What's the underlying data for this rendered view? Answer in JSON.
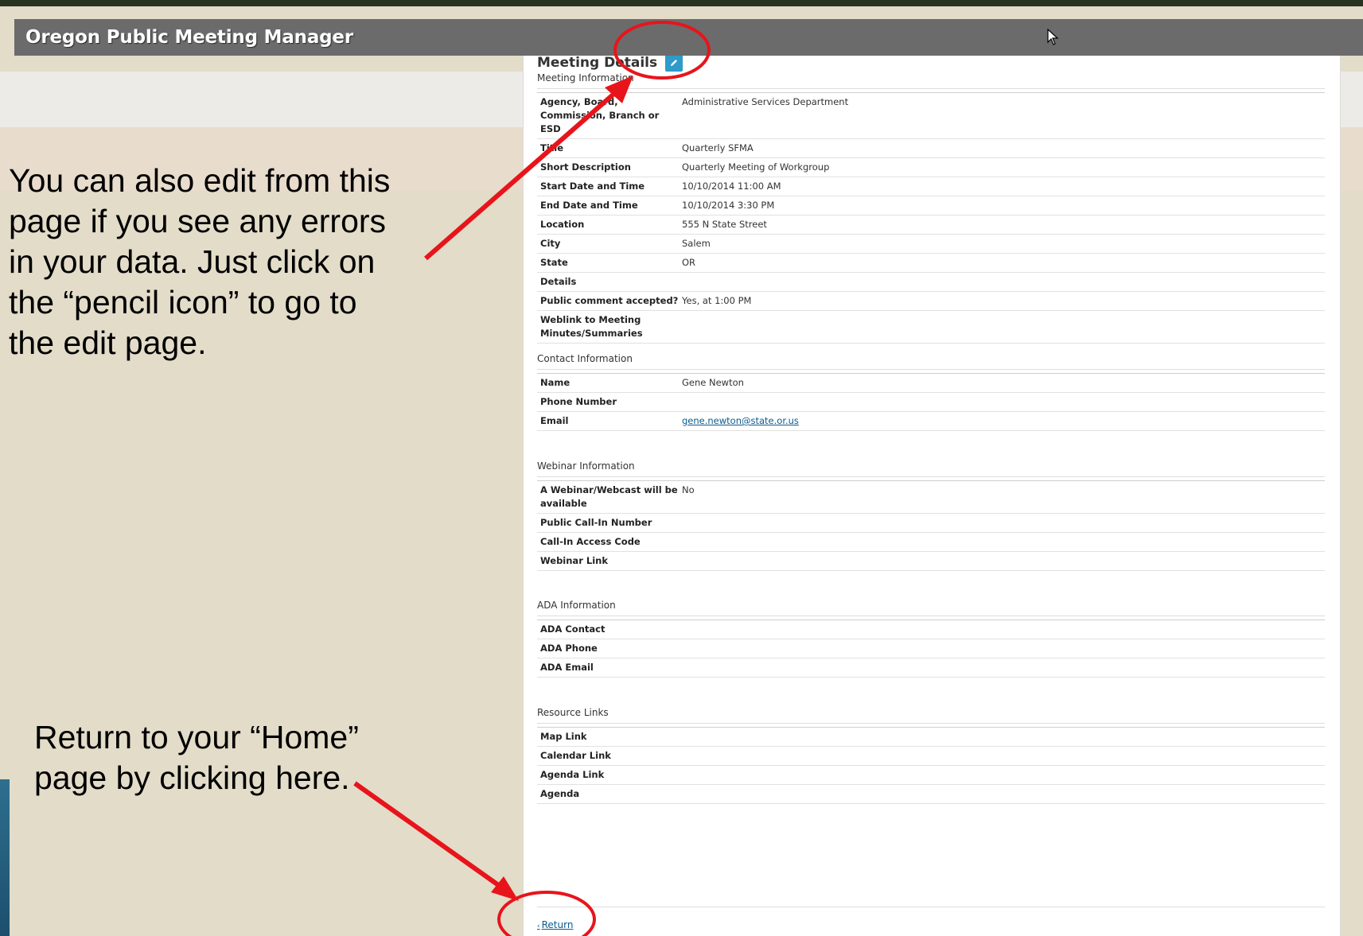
{
  "app": {
    "title": "Oregon Public Meeting Manager"
  },
  "panel": {
    "title": "Meeting Details",
    "edit_icon": "pencil-icon"
  },
  "sections": {
    "meeting": {
      "title": "Meeting Information",
      "rows": [
        {
          "label": "Agency, Board, Commission, Branch or ESD",
          "value": "Administrative Services Department"
        },
        {
          "label": "Title",
          "value": "Quarterly SFMA"
        },
        {
          "label": "Short Description",
          "value": "Quarterly Meeting of Workgroup"
        },
        {
          "label": "Start Date and Time",
          "value": "10/10/2014 11:00 AM"
        },
        {
          "label": "End Date and Time",
          "value": "10/10/2014 3:30 PM"
        },
        {
          "label": "Location",
          "value": "555 N State Street"
        },
        {
          "label": "City",
          "value": "Salem"
        },
        {
          "label": "State",
          "value": "OR"
        },
        {
          "label": "Details",
          "value": ""
        },
        {
          "label": "Public comment accepted?",
          "value": "Yes, at 1:00 PM"
        },
        {
          "label": "Weblink to Meeting Minutes/Summaries",
          "value": ""
        }
      ]
    },
    "contact": {
      "title": "Contact Information",
      "rows": [
        {
          "label": "Name",
          "value": "Gene Newton"
        },
        {
          "label": "Phone Number",
          "value": ""
        },
        {
          "label": "Email",
          "value": "gene.newton@state.or.us"
        }
      ]
    },
    "webinar": {
      "title": "Webinar Information",
      "rows": [
        {
          "label": "A Webinar/Webcast will be available",
          "value": "No"
        },
        {
          "label": "Public Call-In Number",
          "value": ""
        },
        {
          "label": "Call-In Access Code",
          "value": ""
        },
        {
          "label": "Webinar Link",
          "value": ""
        }
      ]
    },
    "ada": {
      "title": "ADA Information",
      "rows": [
        {
          "label": "ADA Contact",
          "value": ""
        },
        {
          "label": "ADA Phone",
          "value": ""
        },
        {
          "label": "ADA Email",
          "value": ""
        }
      ]
    },
    "resources": {
      "title": "Resource Links",
      "rows": [
        {
          "label": "Map Link",
          "value": ""
        },
        {
          "label": "Calendar Link",
          "value": ""
        },
        {
          "label": "Agenda Link",
          "value": ""
        },
        {
          "label": "Agenda",
          "value": ""
        }
      ]
    }
  },
  "return_link": {
    "arrow": "‹",
    "label": "Return"
  },
  "annotations": {
    "edit_note_lines": [
      "You can also edit from this",
      "page if you see any errors",
      "in your data.  Just click on",
      "the “pencil icon” to go to",
      "the edit page."
    ],
    "return_note_lines": [
      "Return to your “Home”",
      "page by clicking here."
    ]
  },
  "colors": {
    "annotation_red": "#e8141b",
    "edit_button": "#2e9bc9",
    "link": "#0b5b8f"
  }
}
